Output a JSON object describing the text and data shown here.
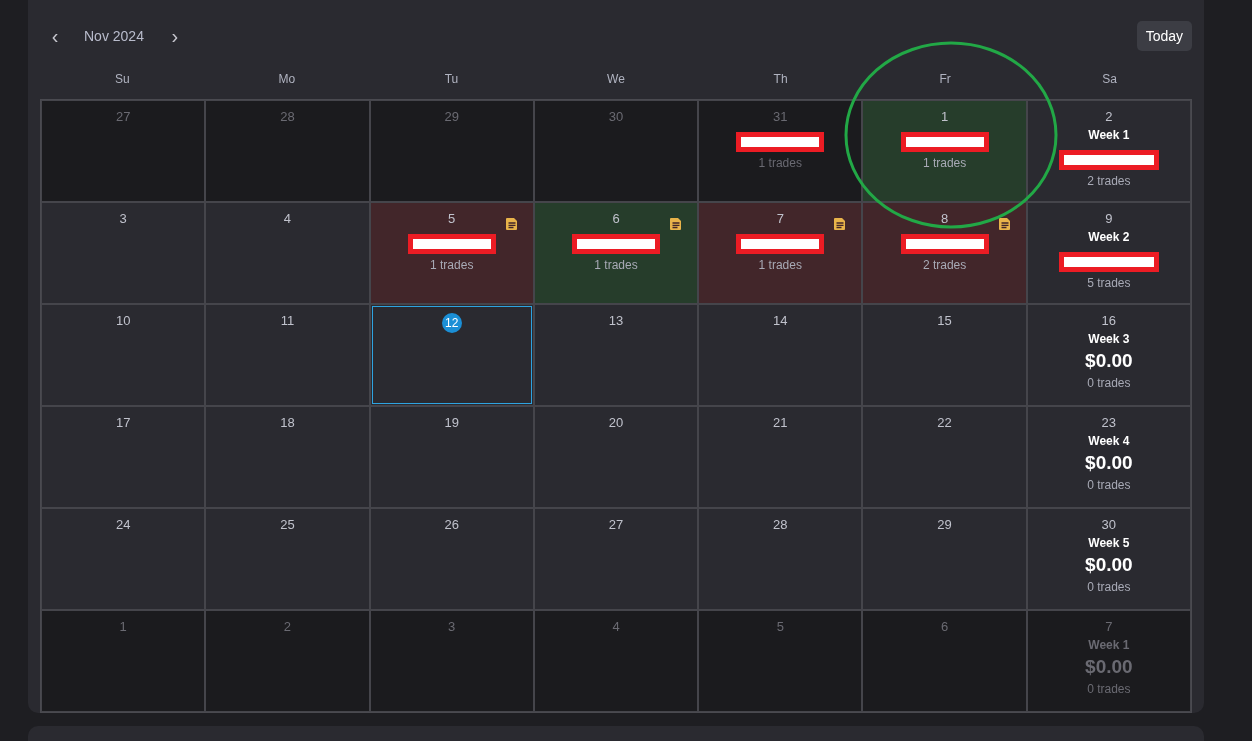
{
  "header": {
    "prev": "‹",
    "month": "Nov 2024",
    "next": "›",
    "today_button": "Today"
  },
  "weekdays": [
    "Su",
    "Mo",
    "Tu",
    "We",
    "Th",
    "Fr",
    "Sa"
  ],
  "weeks": [
    {
      "cells": [
        {
          "day": "27",
          "outside": true,
          "today": false,
          "kind": "plain",
          "note": false
        },
        {
          "day": "28",
          "outside": true,
          "today": false,
          "kind": "plain",
          "note": false
        },
        {
          "day": "29",
          "outside": true,
          "today": false,
          "kind": "plain",
          "note": false
        },
        {
          "day": "30",
          "outside": true,
          "today": false,
          "kind": "plain",
          "note": false
        },
        {
          "day": "31",
          "outside": true,
          "today": false,
          "kind": "plain",
          "note": false,
          "redacted": true,
          "trades": "1 trades"
        },
        {
          "day": "1",
          "outside": false,
          "today": false,
          "kind": "win",
          "note": false,
          "redacted": true,
          "trades": "1 trades"
        },
        {
          "day": "2",
          "outside": false,
          "today": false,
          "kind": "plain",
          "note": false,
          "week": "Week 1",
          "redacted": true,
          "trades": "2 trades"
        }
      ]
    },
    {
      "cells": [
        {
          "day": "3",
          "outside": false,
          "today": false,
          "kind": "plain",
          "note": false
        },
        {
          "day": "4",
          "outside": false,
          "today": false,
          "kind": "plain",
          "note": false
        },
        {
          "day": "5",
          "outside": false,
          "today": false,
          "kind": "loss",
          "note": true,
          "redacted": true,
          "trades": "1 trades"
        },
        {
          "day": "6",
          "outside": false,
          "today": false,
          "kind": "win",
          "note": true,
          "redacted": true,
          "trades": "1 trades"
        },
        {
          "day": "7",
          "outside": false,
          "today": false,
          "kind": "loss",
          "note": true,
          "redacted": true,
          "trades": "1 trades"
        },
        {
          "day": "8",
          "outside": false,
          "today": false,
          "kind": "loss",
          "note": true,
          "redacted": true,
          "trades": "2 trades"
        },
        {
          "day": "9",
          "outside": false,
          "today": false,
          "kind": "plain",
          "note": false,
          "week": "Week 2",
          "redacted": true,
          "trades": "5 trades"
        }
      ]
    },
    {
      "cells": [
        {
          "day": "10",
          "outside": false,
          "today": false,
          "kind": "plain",
          "note": false
        },
        {
          "day": "11",
          "outside": false,
          "today": false,
          "kind": "plain",
          "note": false
        },
        {
          "day": "12",
          "outside": false,
          "today": true,
          "kind": "plain",
          "note": false
        },
        {
          "day": "13",
          "outside": false,
          "today": false,
          "kind": "plain",
          "note": false
        },
        {
          "day": "14",
          "outside": false,
          "today": false,
          "kind": "plain",
          "note": false
        },
        {
          "day": "15",
          "outside": false,
          "today": false,
          "kind": "plain",
          "note": false
        },
        {
          "day": "16",
          "outside": false,
          "today": false,
          "kind": "plain",
          "note": false,
          "week": "Week 3",
          "amount": "$0.00",
          "trades": "0 trades"
        }
      ]
    },
    {
      "cells": [
        {
          "day": "17",
          "outside": false,
          "today": false,
          "kind": "plain",
          "note": false
        },
        {
          "day": "18",
          "outside": false,
          "today": false,
          "kind": "plain",
          "note": false
        },
        {
          "day": "19",
          "outside": false,
          "today": false,
          "kind": "plain",
          "note": false
        },
        {
          "day": "20",
          "outside": false,
          "today": false,
          "kind": "plain",
          "note": false
        },
        {
          "day": "21",
          "outside": false,
          "today": false,
          "kind": "plain",
          "note": false
        },
        {
          "day": "22",
          "outside": false,
          "today": false,
          "kind": "plain",
          "note": false
        },
        {
          "day": "23",
          "outside": false,
          "today": false,
          "kind": "plain",
          "note": false,
          "week": "Week 4",
          "amount": "$0.00",
          "trades": "0 trades"
        }
      ]
    },
    {
      "cells": [
        {
          "day": "24",
          "outside": false,
          "today": false,
          "kind": "plain",
          "note": false
        },
        {
          "day": "25",
          "outside": false,
          "today": false,
          "kind": "plain",
          "note": false
        },
        {
          "day": "26",
          "outside": false,
          "today": false,
          "kind": "plain",
          "note": false
        },
        {
          "day": "27",
          "outside": false,
          "today": false,
          "kind": "plain",
          "note": false
        },
        {
          "day": "28",
          "outside": false,
          "today": false,
          "kind": "plain",
          "note": false
        },
        {
          "day": "29",
          "outside": false,
          "today": false,
          "kind": "plain",
          "note": false
        },
        {
          "day": "30",
          "outside": false,
          "today": false,
          "kind": "plain",
          "note": false,
          "week": "Week 5",
          "amount": "$0.00",
          "trades": "0 trades"
        }
      ]
    },
    {
      "cells": [
        {
          "day": "1",
          "outside": true,
          "today": false,
          "kind": "plain",
          "note": false
        },
        {
          "day": "2",
          "outside": true,
          "today": false,
          "kind": "plain",
          "note": false
        },
        {
          "day": "3",
          "outside": true,
          "today": false,
          "kind": "plain",
          "note": false
        },
        {
          "day": "4",
          "outside": true,
          "today": false,
          "kind": "plain",
          "note": false
        },
        {
          "day": "5",
          "outside": true,
          "today": false,
          "kind": "plain",
          "note": false
        },
        {
          "day": "6",
          "outside": true,
          "today": false,
          "kind": "plain",
          "note": false
        },
        {
          "day": "7",
          "outside": true,
          "today": false,
          "kind": "plain",
          "note": false,
          "week": "Week 1",
          "amount": "$0.00",
          "trades": "0 trades"
        }
      ]
    }
  ]
}
